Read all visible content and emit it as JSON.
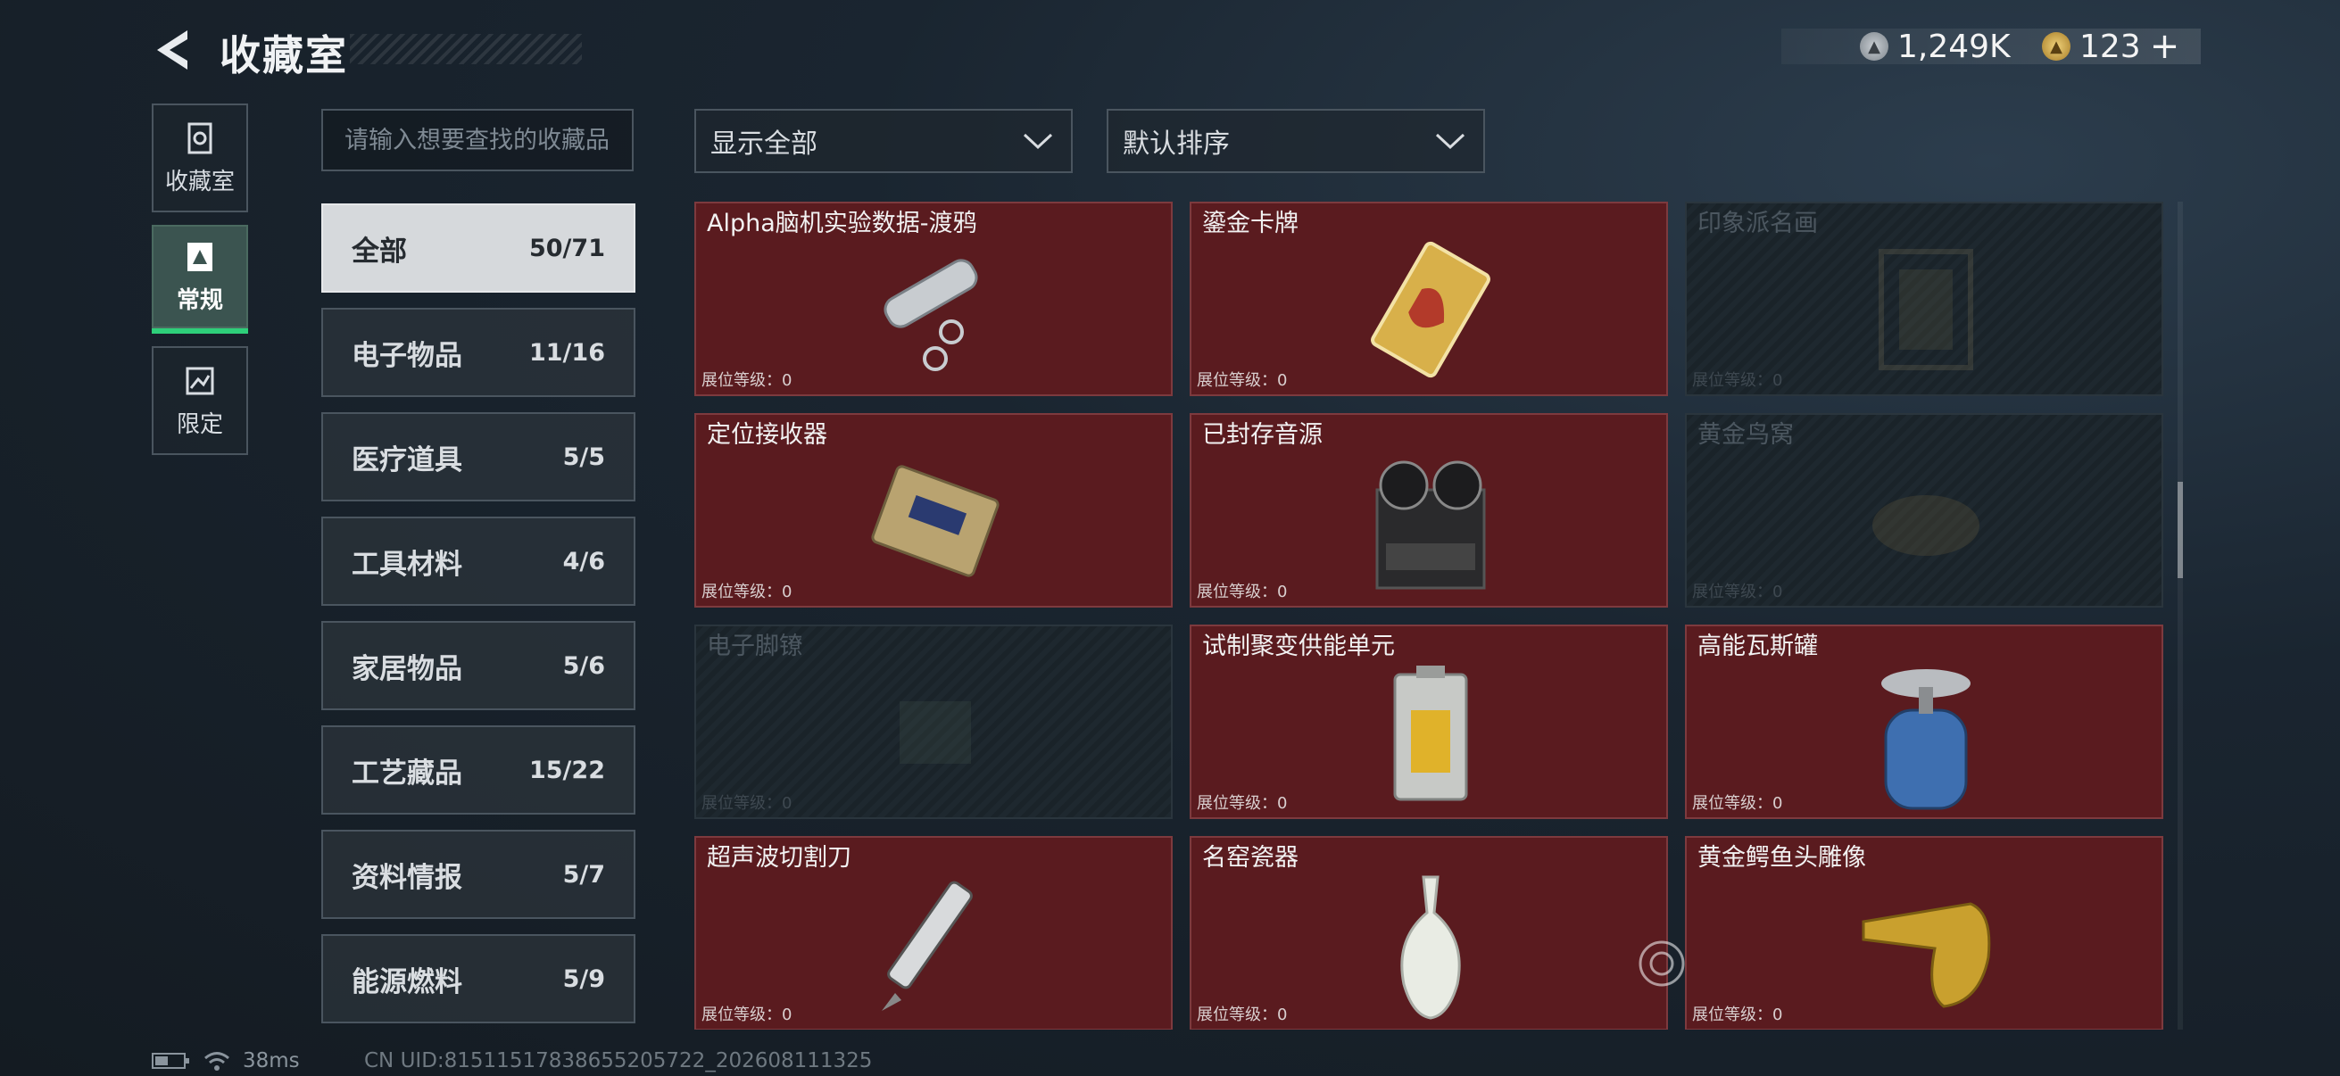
{
  "header": {
    "title": "收藏室",
    "currency_1": "1,249K",
    "currency_2": "123",
    "add_label": "+"
  },
  "side_tabs": [
    {
      "label": "收藏室",
      "icon": "collection-icon",
      "active": false
    },
    {
      "label": "常规",
      "icon": "regular-icon",
      "active": true
    },
    {
      "label": "限定",
      "icon": "limited-icon",
      "active": false
    }
  ],
  "search": {
    "placeholder": "请输入想要查找的收藏品"
  },
  "categories": [
    {
      "label": "全部",
      "count": "50/71",
      "active": true
    },
    {
      "label": "电子物品",
      "count": "11/16"
    },
    {
      "label": "医疗道具",
      "count": "5/5"
    },
    {
      "label": "工具材料",
      "count": "4/6"
    },
    {
      "label": "家居物品",
      "count": "5/6"
    },
    {
      "label": "工艺藏品",
      "count": "15/22"
    },
    {
      "label": "资料情报",
      "count": "5/7"
    },
    {
      "label": "能源燃料",
      "count": "5/9"
    }
  ],
  "filters": {
    "show": "显示全部",
    "sort": "默认排序"
  },
  "items": [
    {
      "name": "Alpha脑机实验数据-渡鸦",
      "level": "展位等级：0",
      "owned": true,
      "icon": "data-drive-icon"
    },
    {
      "name": "鎏金卡牌",
      "level": "展位等级：0",
      "owned": true,
      "icon": "gold-card-icon"
    },
    {
      "name": "印象派名画",
      "level": "展位等级：0",
      "owned": false,
      "icon": "painting-icon"
    },
    {
      "name": "定位接收器",
      "level": "展位等级：0",
      "owned": true,
      "icon": "receiver-icon"
    },
    {
      "name": "已封存音源",
      "level": "展位等级：0",
      "owned": true,
      "icon": "tape-recorder-icon"
    },
    {
      "name": "黄金鸟窝",
      "level": "展位等级：0",
      "owned": false,
      "icon": "bird-nest-icon"
    },
    {
      "name": "电子脚镣",
      "level": "展位等级：0",
      "owned": false,
      "icon": "ankle-monitor-icon"
    },
    {
      "name": "试制聚变供能单元",
      "level": "展位等级：0",
      "owned": true,
      "icon": "fusion-cell-icon"
    },
    {
      "name": "高能瓦斯罐",
      "level": "展位等级：0",
      "owned": true,
      "icon": "gas-canister-icon"
    },
    {
      "name": "超声波切割刀",
      "level": "展位等级：0",
      "owned": true,
      "icon": "cutter-icon"
    },
    {
      "name": "名窑瓷器",
      "level": "展位等级：0",
      "owned": true,
      "icon": "porcelain-vase-icon"
    },
    {
      "name": "黄金鳄鱼头雕像",
      "level": "展位等级：0",
      "owned": true,
      "icon": "croc-statue-icon"
    }
  ],
  "footer": {
    "ping": "38ms",
    "uid": "CN UID:8151151783865520572​2_202608111325"
  }
}
